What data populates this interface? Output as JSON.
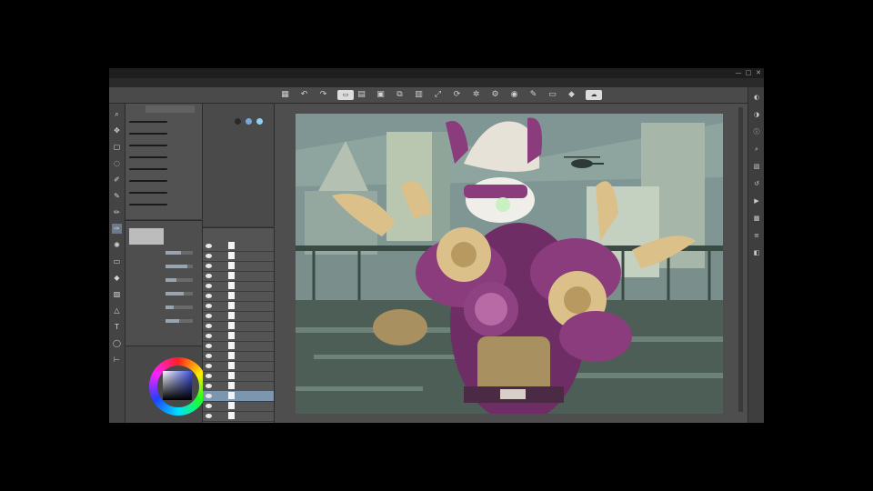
{
  "window": {
    "title": "",
    "controls": [
      "—",
      "□",
      "✕"
    ]
  },
  "menubar": {
    "items": [
      "",
      "",
      "",
      "",
      "",
      "",
      "",
      "",
      "",
      "",
      "",
      ""
    ]
  },
  "commandbar": {
    "icons": [
      "grid-icon",
      "undo-icon",
      "redo-icon",
      "new-icon",
      "open-icon",
      "save-icon",
      "copy-icon",
      "paste-icon",
      "transform-icon",
      "rotate-icon",
      "star-icon",
      "settings-icon",
      "view-icon",
      "pen-icon",
      "eraser-icon",
      "fill-icon",
      "cloud-icon"
    ]
  },
  "left_tools": {
    "icons": [
      "zoom-icon",
      "move-icon",
      "selection-icon",
      "lasso-icon",
      "eyedropper-icon",
      "pen-icon",
      "pencil-icon",
      "brush-icon",
      "airbrush-icon",
      "eraser-icon",
      "fill-icon",
      "gradient-icon",
      "figure-icon",
      "text-icon",
      "balloon-icon",
      "ruler-icon"
    ],
    "active_index": 7
  },
  "subtool": {
    "tabs": [
      "",
      "",
      ""
    ],
    "brushes": [
      {
        "label": ""
      },
      {
        "label": ""
      },
      {
        "label": ""
      },
      {
        "label": ""
      },
      {
        "label": ""
      },
      {
        "label": ""
      },
      {
        "label": ""
      },
      {
        "label": ""
      }
    ]
  },
  "tool_property": {
    "rows": [
      {
        "label": "",
        "level": 0.55
      },
      {
        "label": "",
        "level": 0.8
      },
      {
        "label": "",
        "level": 0.4
      },
      {
        "label": "",
        "level": 0.65
      },
      {
        "label": "",
        "level": 0.3
      },
      {
        "label": "",
        "level": 0.5
      }
    ]
  },
  "color_wheel": {
    "current_color": "#4050e0"
  },
  "layer_property": {
    "label": "",
    "colors": [
      "#2a2a2a",
      "#7aa8d8",
      "#8fd0f0"
    ]
  },
  "layers": {
    "rows": [
      {
        "name": "",
        "selected": false
      },
      {
        "name": "",
        "selected": false
      },
      {
        "name": "",
        "selected": false
      },
      {
        "name": "",
        "selected": false
      },
      {
        "name": "",
        "selected": false
      },
      {
        "name": "",
        "selected": false
      },
      {
        "name": "",
        "selected": false
      },
      {
        "name": "",
        "selected": false
      },
      {
        "name": "",
        "selected": false
      },
      {
        "name": "",
        "selected": false
      },
      {
        "name": "",
        "selected": false
      },
      {
        "name": "",
        "selected": false
      },
      {
        "name": "",
        "selected": false
      },
      {
        "name": "",
        "selected": false
      },
      {
        "name": "",
        "selected": false
      },
      {
        "name": "",
        "selected": true
      },
      {
        "name": "",
        "selected": false
      },
      {
        "name": "",
        "selected": false
      }
    ]
  },
  "canvas": {
    "artwork_colors": {
      "sky": "#7f9694",
      "building": "#b9c7b0",
      "floor": "#4c5e55",
      "armor": "#8a3c7c",
      "bunny": "#dcc08a",
      "skin": "#a89060"
    }
  },
  "right_tools": {
    "icons": [
      "navigator-icon",
      "sub-view-icon",
      "info-icon",
      "layer-search-icon",
      "material-icon",
      "history-icon",
      "auto-action-icon",
      "color-set-icon",
      "slider-icon",
      "intermediate-icon"
    ]
  }
}
